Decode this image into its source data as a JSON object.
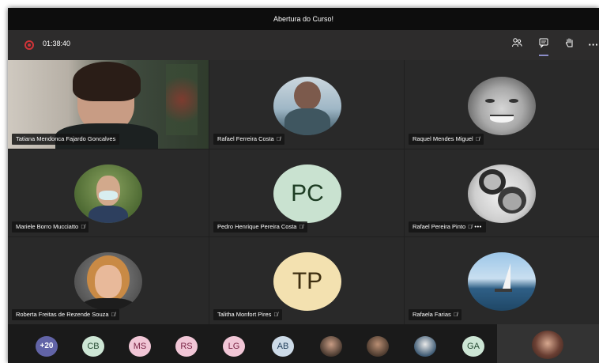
{
  "window": {
    "title": "Abertura do Curso!"
  },
  "toolbar": {
    "timer": "01:38:40",
    "icons": [
      "participants-icon",
      "chat-icon",
      "raise-hand-icon",
      "more-actions-icon"
    ]
  },
  "participants": [
    {
      "name": "Tatiana Mendonca Fajardo Goncalves",
      "video": true,
      "muted": false
    },
    {
      "name": "Rafael Ferreira Costa",
      "muted": true
    },
    {
      "name": "Raquel Mendes Miguel",
      "muted": true
    },
    {
      "name": "Mariele Borro Mucciatto",
      "muted": true
    },
    {
      "name": "Pedro Henrique Pereira Costa",
      "initials": "PC",
      "muted": true
    },
    {
      "name": "Rafael Pereira Pinto",
      "muted": true,
      "more": "•••"
    },
    {
      "name": "Roberta Freitas de Rezende Souza",
      "muted": true
    },
    {
      "name": "Talitha Monfort Pires",
      "initials": "TP",
      "muted": true
    },
    {
      "name": "Rafaela Farias",
      "muted": true
    }
  ],
  "overflow": {
    "more_count": "+20",
    "chips": [
      "CB",
      "MS",
      "RS",
      "LG",
      "AB",
      "",
      "",
      "",
      "GA"
    ]
  },
  "colors": {
    "pc_avatar": "#c9e2d0",
    "tp_avatar": "#f3e1b0",
    "more_chip": "#6264a7",
    "mute_icon": "#dddddd"
  }
}
